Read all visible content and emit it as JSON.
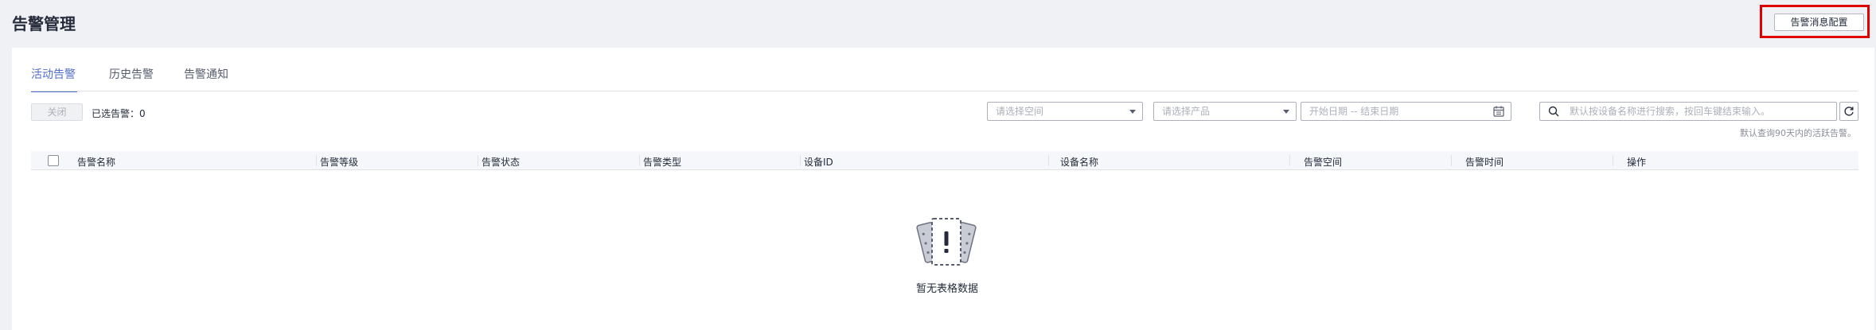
{
  "header": {
    "title": "告警管理",
    "config_button": "告警消息配置"
  },
  "tabs": [
    {
      "label": "活动告警",
      "active": true
    },
    {
      "label": "历史告警",
      "active": false
    },
    {
      "label": "告警通知",
      "active": false
    }
  ],
  "toolbar": {
    "close_label": "关闭",
    "selected_count": "已选告警：0",
    "space_placeholder": "请选择空间",
    "product_placeholder": "请选择产品",
    "date_placeholder": "开始日期 -- 结束日期",
    "search_placeholder": "默认按设备名称进行搜索，按回车键结束输入。",
    "hint": "默认查询90天内的活跃告警。"
  },
  "table": {
    "columns": [
      "告警名称",
      "告警等级",
      "告警状态",
      "告警类型",
      "设备ID",
      "设备名称",
      "告警空间",
      "告警时间",
      "操作"
    ],
    "rows": [],
    "empty_text": "暂无表格数据"
  },
  "colors": {
    "accent": "#526ecc",
    "highlight_frame": "#e00000",
    "page_background": "#f0f1f5"
  }
}
